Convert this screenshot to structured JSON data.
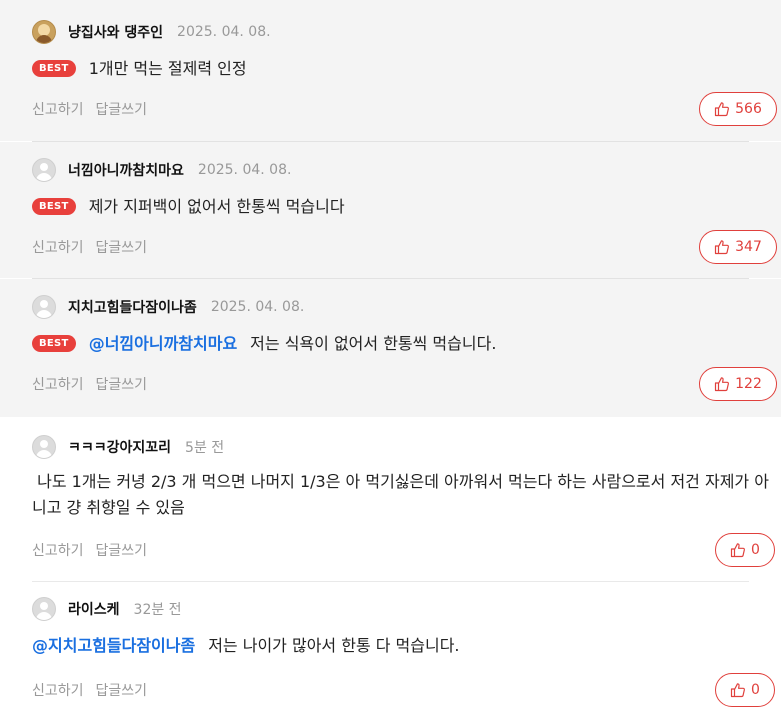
{
  "comments": [
    {
      "id": 1,
      "best": true,
      "avatar": "photo",
      "nickname": "냥집사와 댕주인",
      "date": "2025. 04. 08.",
      "badge": "BEST",
      "mention": "",
      "text": "1개만 먹는 절제력 인정",
      "report_label": "신고하기",
      "reply_label": "답글쓰기",
      "likes": "566"
    },
    {
      "id": 2,
      "best": true,
      "avatar": "default",
      "nickname": "너낌아니까참치마요",
      "date": "2025. 04. 08.",
      "badge": "BEST",
      "mention": "",
      "text": "제가 지퍼백이 없어서 한통씩 먹습니다",
      "report_label": "신고하기",
      "reply_label": "답글쓰기",
      "likes": "347"
    },
    {
      "id": 3,
      "best": true,
      "avatar": "default",
      "nickname": "지치고힘들다잠이나좀",
      "date": "2025. 04. 08.",
      "badge": "BEST",
      "mention": "@너낌아니까참치마요",
      "text": "저는 식욕이 없어서 한통씩 먹습니다.",
      "report_label": "신고하기",
      "reply_label": "답글쓰기",
      "likes": "122"
    },
    {
      "id": 4,
      "best": false,
      "avatar": "default",
      "nickname": "ㅋㅋㅋ강아지꼬리",
      "date": "5분 전",
      "badge": "",
      "mention": "",
      "text": " 나도 1개는 커녕 2/3 개 먹으면 나머지 1/3은 아 먹기싫은데 아까워서 먹는다 하는 사람으로서 저건 자제가 아니고 걍 취향일 수 있음",
      "report_label": "신고하기",
      "reply_label": "답글쓰기",
      "likes": "0"
    },
    {
      "id": 5,
      "best": false,
      "avatar": "default",
      "nickname": "라이스케",
      "date": "32분 전",
      "badge": "",
      "mention": "@지치고힘들다잠이나좀",
      "text": "저는 나이가 많아서 한통 다 먹습니다.",
      "report_label": "신고하기",
      "reply_label": "답글쓰기",
      "likes": "0"
    }
  ],
  "icons": {
    "like": "thumbs-up-icon",
    "avatar": "user-avatar-icon"
  },
  "colors": {
    "accent": "#e0403c",
    "badge": "#e8403c",
    "mention": "#1a6fe0",
    "best_bg": "#f4f4f4"
  }
}
